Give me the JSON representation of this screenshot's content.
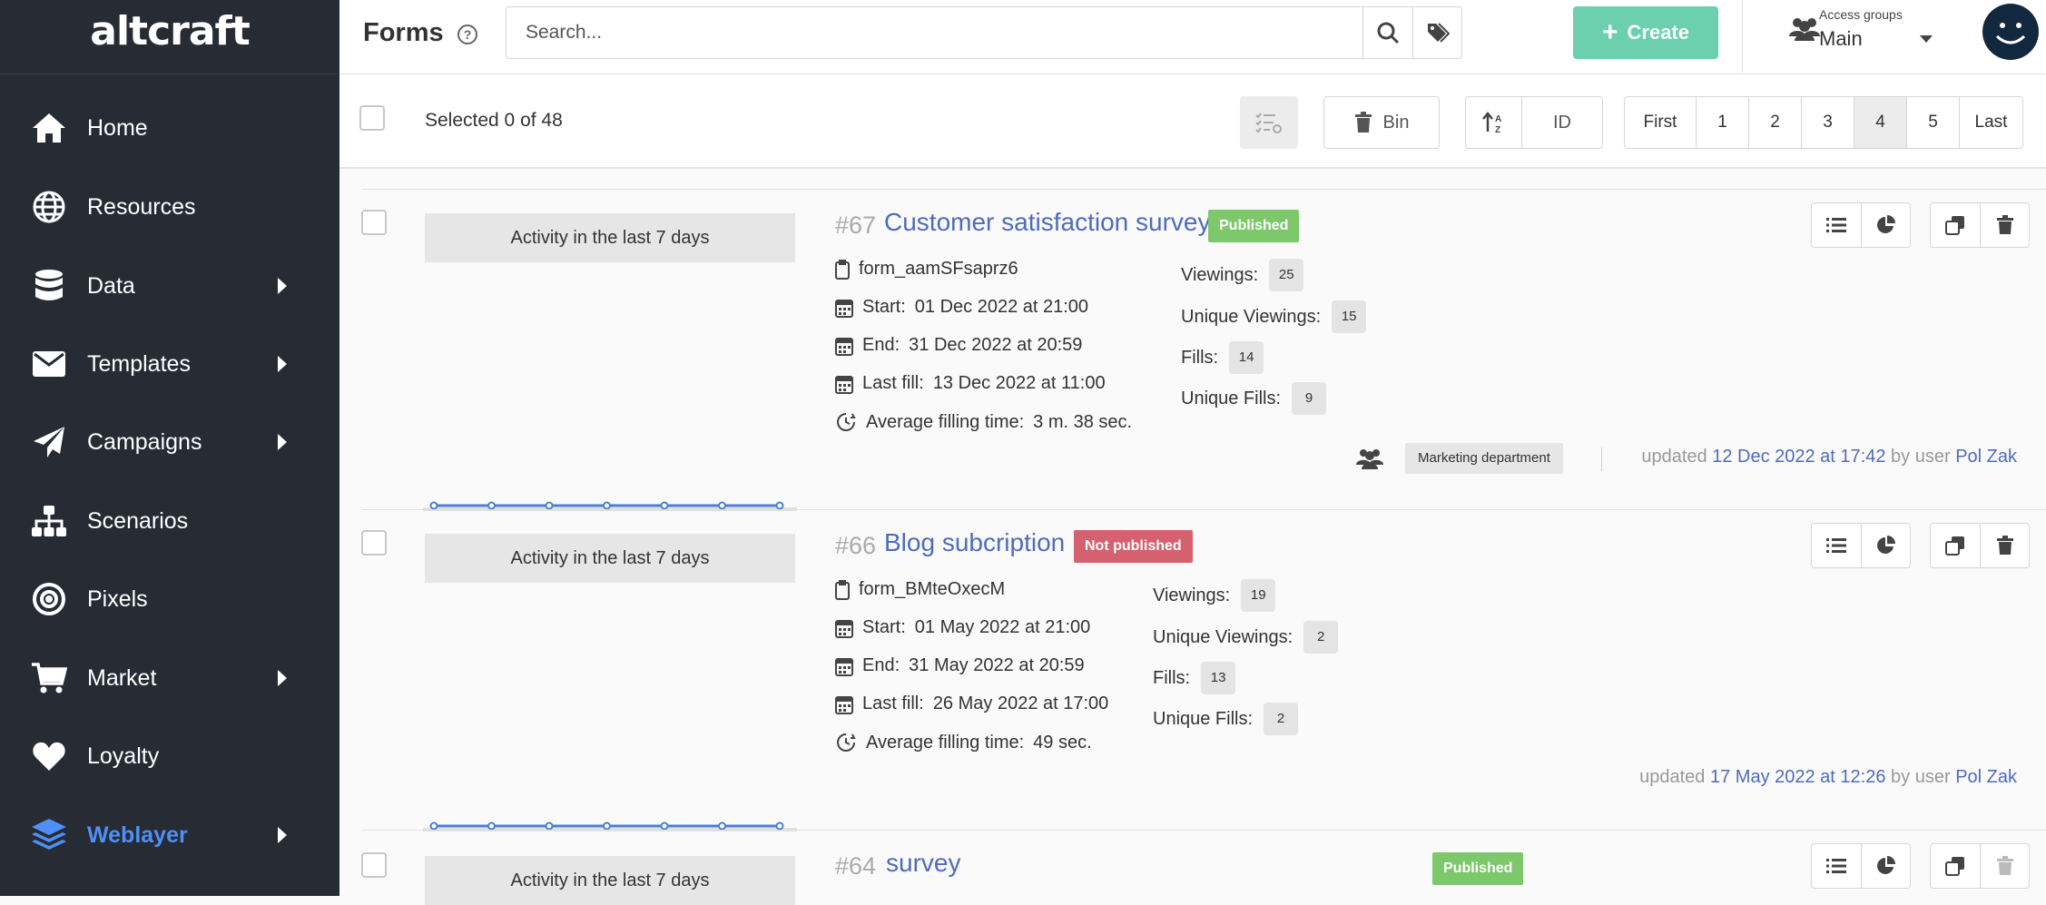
{
  "brand": {
    "logo_text": "altcraft"
  },
  "sidebar": {
    "items": [
      {
        "label": "Home",
        "icon": "home-icon",
        "has_arrow": false
      },
      {
        "label": "Resources",
        "icon": "globe-icon",
        "has_arrow": false
      },
      {
        "label": "Data",
        "icon": "database-icon",
        "has_arrow": true
      },
      {
        "label": "Templates",
        "icon": "envelope-icon",
        "has_arrow": true
      },
      {
        "label": "Campaigns",
        "icon": "paper-plane-icon",
        "has_arrow": true
      },
      {
        "label": "Scenarios",
        "icon": "sitemap-icon",
        "has_arrow": false
      },
      {
        "label": "Pixels",
        "icon": "target-icon",
        "has_arrow": false
      },
      {
        "label": "Market",
        "icon": "cart-icon",
        "has_arrow": true
      },
      {
        "label": "Loyalty",
        "icon": "heart-icon",
        "has_arrow": false
      },
      {
        "label": "Weblayer",
        "icon": "layers-icon",
        "has_arrow": true,
        "active": true
      }
    ]
  },
  "header": {
    "title": "Forms",
    "search_placeholder": "Search...",
    "create_label": "Create",
    "access_small": "Access groups",
    "access_value": "Main"
  },
  "toolbar": {
    "selected_text": "Selected 0 of 48",
    "bin_label": "Bin",
    "sort_label": "ID",
    "pages": [
      "First",
      "1",
      "2",
      "3",
      "4",
      "5",
      "Last"
    ],
    "current_page": "4"
  },
  "colors": {
    "sidebar_bg": "#262b34",
    "accent": "#4f8ff7",
    "create": "#6ccfae",
    "published": "#7cc86b",
    "not_published": "#d6616e",
    "link": "#4f6bbd"
  },
  "forms": [
    {
      "id": "#67",
      "title": "Customer satisfaction survey",
      "status": "Published",
      "activity_label": "Activity in the last 7 days",
      "activity": [
        0,
        0,
        0,
        0,
        0,
        0,
        0
      ],
      "code": "form_aamSFsaprz6",
      "start_label": "Start:",
      "start": "01 Dec 2022 at 21:00",
      "end_label": "End:",
      "end": "31 Dec 2022 at 20:59",
      "lastfill_label": "Last fill:",
      "lastfill": "13 Dec 2022 at 11:00",
      "avg_label": "Average filling time:",
      "avg": "3 m. 38 sec.",
      "viewings_label": "Viewings:",
      "viewings": "25",
      "unique_viewings_label": "Unique Viewings:",
      "unique_viewings": "15",
      "fills_label": "Fills:",
      "fills": "14",
      "unique_fills_label": "Unique Fills:",
      "unique_fills": "9",
      "group": "Marketing department",
      "updated_prefix": "updated",
      "updated_date": "12 Dec 2022 at 17:42",
      "updated_by": "by user",
      "updated_user": "Pol Zak"
    },
    {
      "id": "#66",
      "title": "Blog subcription",
      "status": "Not published",
      "activity_label": "Activity in the last 7 days",
      "activity": [
        0,
        0,
        0,
        0,
        0,
        0,
        0
      ],
      "code": "form_BMteOxecM",
      "start_label": "Start:",
      "start": "01 May 2022 at 21:00",
      "end_label": "End:",
      "end": "31 May 2022 at 20:59",
      "lastfill_label": "Last fill:",
      "lastfill": "26 May 2022 at 17:00",
      "avg_label": "Average filling time:",
      "avg": "49 sec.",
      "viewings_label": "Viewings:",
      "viewings": "19",
      "unique_viewings_label": "Unique Viewings:",
      "unique_viewings": "2",
      "fills_label": "Fills:",
      "fills": "13",
      "unique_fills_label": "Unique Fills:",
      "unique_fills": "2",
      "updated_prefix": "updated",
      "updated_date": "17 May 2022 at 12:26",
      "updated_by": "by user",
      "updated_user": "Pol Zak"
    },
    {
      "id": "#64",
      "title": "survey",
      "status": "Published",
      "activity_label": "Activity in the last 7 days"
    }
  ]
}
